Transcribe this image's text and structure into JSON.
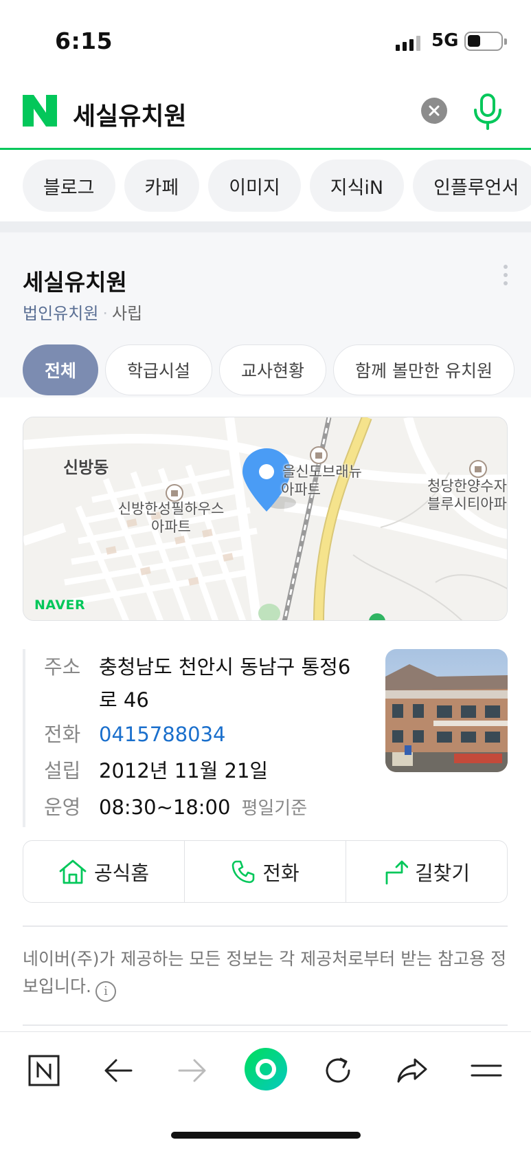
{
  "status_bar": {
    "time": "6:15",
    "network": "5G"
  },
  "search": {
    "query": "세실유치원"
  },
  "chips": [
    "블로그",
    "카페",
    "이미지",
    "지식iN",
    "인플루언서"
  ],
  "place": {
    "name": "세실유치원",
    "category": "법인유치원",
    "type": "사립",
    "filter_tabs": [
      "전체",
      "학급시설",
      "교사현황",
      "함께 볼만한 유치원"
    ],
    "map": {
      "labels": [
        "신방동",
        "신방한성필하우스",
        "아파트",
        "을신도브래뉴",
        "아파트",
        "청당한양수자",
        "블루시티아파"
      ],
      "watermark": "NAVER"
    },
    "info": {
      "address_key": "주소",
      "address_line1": "충청남도 천안시 동남구 통정6",
      "address_line2": "로 46",
      "phone_key": "전화",
      "phone": "0415788034",
      "founded_key": "설립",
      "founded": "2012년 11월 21일",
      "hours_key": "운영",
      "hours": "08:30~18:00",
      "hours_note": "평일기준"
    },
    "actions": [
      {
        "label": "공식홈",
        "icon": "home-icon"
      },
      {
        "label": "전화",
        "icon": "phone-icon"
      },
      {
        "label": "길찾기",
        "icon": "directions-icon"
      }
    ],
    "disclaimer": "네이버(주)가 제공하는 모든 정보는 각 제공처로부터 받는 참고용 정보입니다.",
    "info_glyph": "i"
  },
  "colors": {
    "brand": "#03c75a",
    "active_tab": "#7c8cb1",
    "link": "#1a6fcc",
    "pin": "#4a9cf5"
  }
}
